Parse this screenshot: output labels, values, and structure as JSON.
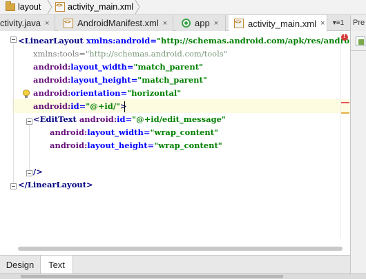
{
  "breadcrumb": {
    "items": [
      {
        "label": "layout",
        "icon": "folder-icon"
      },
      {
        "label": "activity_main.xml",
        "icon": "xml-file-icon"
      }
    ]
  },
  "tabs": [
    {
      "label": "ctivity.java",
      "close": "×",
      "icon": "",
      "active": false
    },
    {
      "label": "AndroidManifest.xml",
      "close": "×",
      "icon": "xml-file-icon",
      "active": false
    },
    {
      "label": "app",
      "close": "×",
      "icon": "app-module-icon",
      "active": false
    },
    {
      "label": "activity_main.xml",
      "close": "×",
      "icon": "xml-file-icon",
      "active": true
    }
  ],
  "tab_overflow": {
    "label": "▾≡1"
  },
  "preview_tab": {
    "label": "Pre"
  },
  "editor": {
    "lines": [
      {
        "parts": [
          {
            "cls": "tag",
            "t": "<LinearLayout "
          },
          {
            "cls": "attr",
            "t": "xmlns:android="
          },
          {
            "cls": "str",
            "t": "\"http://schemas.android.com/apk/res/andro"
          }
        ]
      },
      {
        "parts": [
          {
            "cls": "ns-dim",
            "t": "xmlns:tools="
          },
          {
            "cls": "str-dim",
            "t": "\"http://schemas.android.com/tools\""
          }
        ]
      },
      {
        "parts": [
          {
            "cls": "ns",
            "t": "android:"
          },
          {
            "cls": "attr",
            "t": "layout_width="
          },
          {
            "cls": "str",
            "t": "\"match_parent\""
          }
        ]
      },
      {
        "parts": [
          {
            "cls": "ns",
            "t": "android:"
          },
          {
            "cls": "attr",
            "t": "layout_height="
          },
          {
            "cls": "str",
            "t": "\"match_parent\""
          }
        ]
      },
      {
        "parts": [
          {
            "cls": "ns",
            "t": "android:"
          },
          {
            "cls": "attr",
            "t": "orientation="
          },
          {
            "cls": "str",
            "t": "\"horizontal\""
          }
        ]
      },
      {
        "parts": [
          {
            "cls": "ns",
            "t": "android:"
          },
          {
            "cls": "attr",
            "t": "id="
          },
          {
            "cls": "str",
            "t": "\"@+id/\""
          },
          {
            "cls": "tag",
            "t": ">"
          }
        ]
      },
      {
        "parts": [
          {
            "cls": "tag",
            "t": "<EditText "
          },
          {
            "cls": "ns",
            "t": "android:"
          },
          {
            "cls": "attr",
            "t": "id="
          },
          {
            "cls": "str",
            "t": "\"@+id/edit_message\""
          }
        ]
      },
      {
        "parts": [
          {
            "cls": "ns",
            "t": "android:"
          },
          {
            "cls": "attr",
            "t": "layout_width="
          },
          {
            "cls": "str",
            "t": "\"wrap_content\""
          }
        ]
      },
      {
        "parts": [
          {
            "cls": "ns",
            "t": "android:"
          },
          {
            "cls": "attr",
            "t": "layout_height="
          },
          {
            "cls": "str",
            "t": "\"wrap_content\""
          }
        ]
      },
      {
        "parts": []
      },
      {
        "parts": [
          {
            "cls": "tag",
            "t": "/>"
          }
        ]
      },
      {
        "parts": [
          {
            "cls": "tag",
            "t": "</LinearLayout>"
          }
        ]
      }
    ]
  },
  "bottom_tabs": [
    {
      "label": "Design",
      "active": false
    },
    {
      "label": "Text",
      "active": true
    }
  ],
  "colors": {
    "error_marker": "#e45656",
    "warning_marker": "#e6b04a",
    "caret_line": "#fdfbe0"
  }
}
